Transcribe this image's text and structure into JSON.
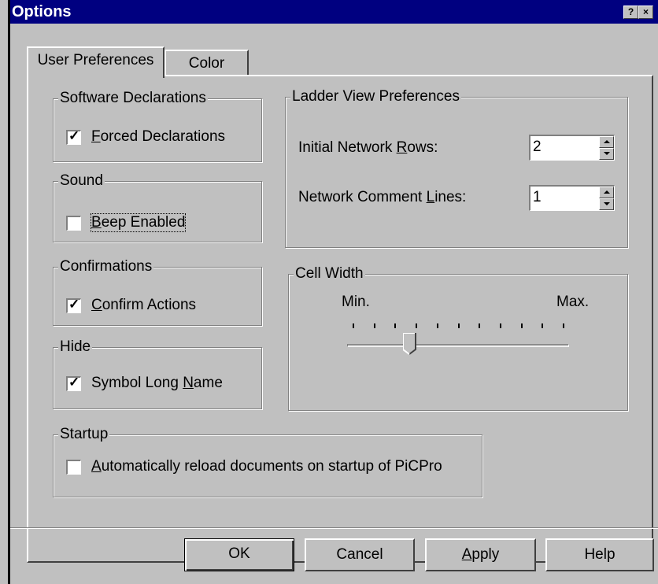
{
  "window": {
    "title": "Options",
    "help_glyph": "?",
    "close_glyph": "×"
  },
  "tabs": [
    {
      "label": "User Preferences",
      "active": true
    },
    {
      "label": "Color",
      "active": false
    }
  ],
  "groups": {
    "software_declarations": {
      "label": "Software Declarations",
      "checkbox": {
        "pre": "",
        "key": "F",
        "post": "orced Declarations",
        "checked": true
      }
    },
    "sound": {
      "label": "Sound",
      "checkbox": {
        "pre": "",
        "key": "B",
        "post": "eep Enabled",
        "checked": false
      }
    },
    "confirmations": {
      "label": "Confirmations",
      "checkbox": {
        "pre": "",
        "key": "C",
        "post": "onfirm Actions",
        "checked": true
      }
    },
    "hide": {
      "label": "Hide",
      "checkbox": {
        "pre": "Symbol Long ",
        "key": "N",
        "post": "ame",
        "checked": true
      }
    },
    "startup": {
      "label": "Startup",
      "checkbox": {
        "pre": "",
        "key": "A",
        "post": "utomatically reload documents on startup of PiCPro",
        "checked": false
      }
    },
    "ladder_view": {
      "label": "Ladder View Preferences",
      "rows": {
        "pre": "Initial Network ",
        "key": "R",
        "post": "ows:",
        "value": "2"
      },
      "comment_lines": {
        "pre": "Network Comment ",
        "key": "L",
        "post": "ines:",
        "value": "1"
      }
    },
    "cell_width": {
      "label": "Cell Width",
      "min_label": "Min.",
      "max_label": "Max.",
      "tick_count": 11,
      "value": 0.27
    }
  },
  "buttons": {
    "ok": "OK",
    "cancel": "Cancel",
    "apply_key": "A",
    "apply_rest": "pply",
    "help": "Help"
  },
  "check_glyph": "✓",
  "colors": {
    "titlebar": "#000080",
    "face": "#c0c0c0"
  }
}
